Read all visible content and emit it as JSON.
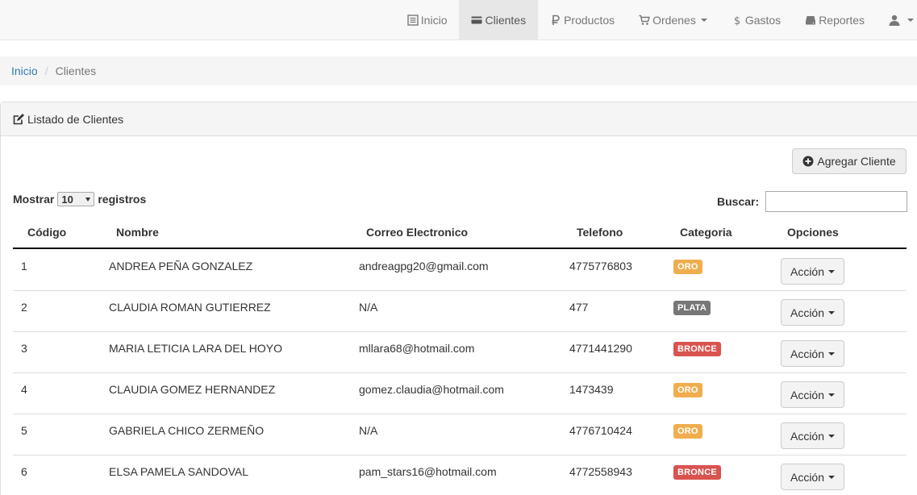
{
  "nav": {
    "items": [
      {
        "label": "Inicio",
        "icon": "list-alt-icon"
      },
      {
        "label": "Clientes",
        "icon": "credit-card-icon",
        "active": true
      },
      {
        "label": "Productos",
        "icon": "ruble-icon"
      },
      {
        "label": "Ordenes",
        "icon": "shopping-cart-icon",
        "dropdown": true
      },
      {
        "label": "Gastos",
        "icon": "dollar-icon"
      },
      {
        "label": "Reportes",
        "icon": "hdd-icon"
      }
    ],
    "user_icon": "user-icon"
  },
  "breadcrumb": {
    "home": "Inicio",
    "separator": "/",
    "current": "Clientes"
  },
  "panel": {
    "title": "Listado de Clientes",
    "add_button": "Agregar Cliente"
  },
  "table_controls": {
    "show_label": "Mostrar",
    "page_size": "10",
    "records_label": "registros",
    "search_label": "Buscar:",
    "search_value": ""
  },
  "table": {
    "headers": {
      "code": "Código",
      "name": "Nombre",
      "email": "Correo Electronico",
      "phone": "Telefono",
      "category": "Categoria",
      "options": "Opciones"
    },
    "action_label": "Acción",
    "rows": [
      {
        "code": "1",
        "name": "ANDREA PEÑA GONZALEZ",
        "email": "andreagpg20@gmail.com",
        "phone": "4775776803",
        "category": "ORO"
      },
      {
        "code": "2",
        "name": "CLAUDIA ROMAN GUTIERREZ",
        "email": "N/A",
        "phone": "477",
        "category": "PLATA"
      },
      {
        "code": "3",
        "name": "MARIA LETICIA LARA DEL HOYO",
        "email": "mllara68@hotmail.com",
        "phone": "4771441290",
        "category": "BRONCE"
      },
      {
        "code": "4",
        "name": "CLAUDIA GOMEZ HERNANDEZ",
        "email": "gomez.claudia@hotmail.com",
        "phone": "1473439",
        "category": "ORO"
      },
      {
        "code": "5",
        "name": "GABRIELA CHICO ZERMEÑO",
        "email": "N/A",
        "phone": "4776710424",
        "category": "ORO"
      },
      {
        "code": "6",
        "name": "ELSA PAMELA SANDOVAL",
        "email": "pam_stars16@hotmail.com",
        "phone": "4772558943",
        "category": "BRONCE"
      }
    ]
  },
  "colors": {
    "ORO": "#f0ad4e",
    "PLATA": "#777777",
    "BRONCE": "#d9534f",
    "link": "#337ab7"
  }
}
